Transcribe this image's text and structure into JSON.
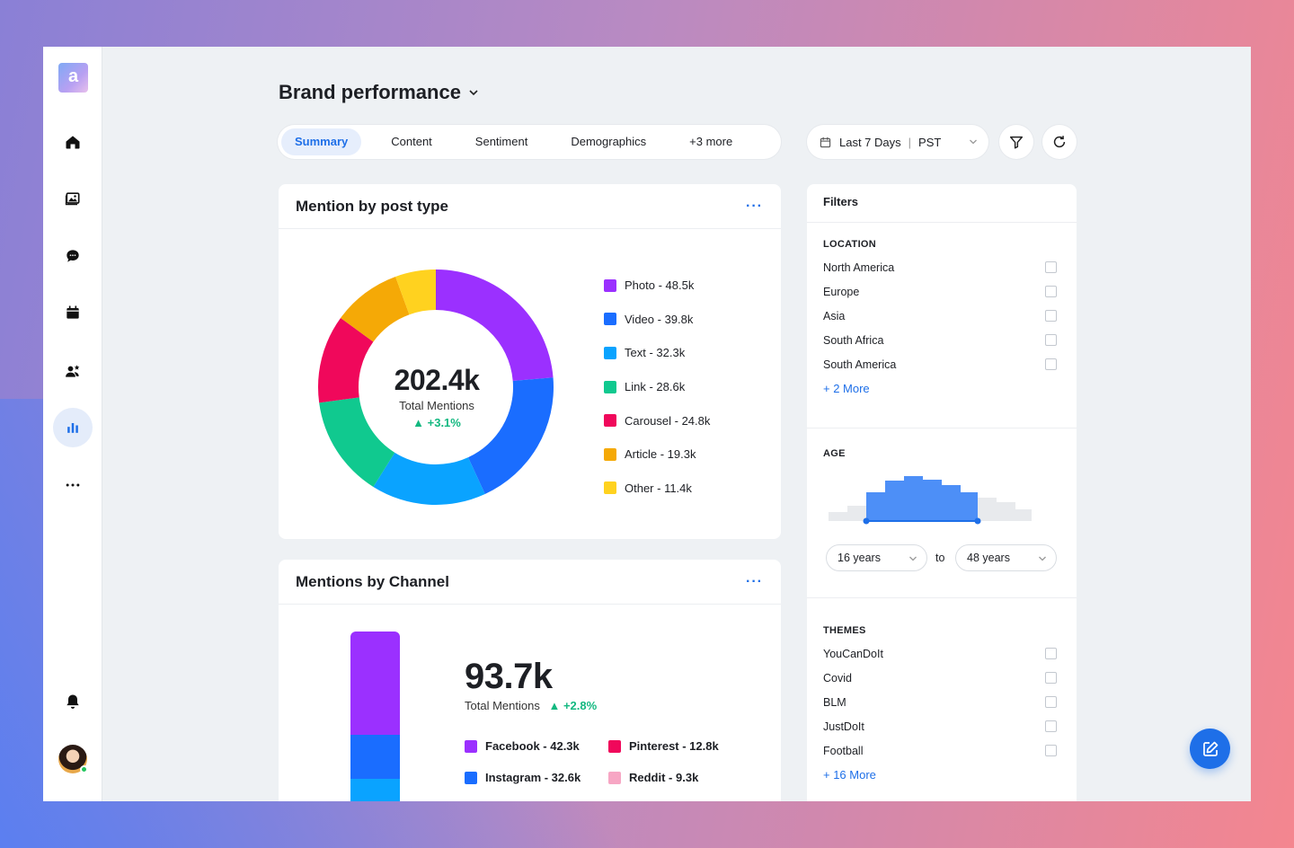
{
  "app": {
    "logo_letter": "a"
  },
  "sidebar": {
    "items": [
      {
        "name": "home",
        "icon": "home-icon"
      },
      {
        "name": "media",
        "icon": "image-icon"
      },
      {
        "name": "messages",
        "icon": "chat-icon"
      },
      {
        "name": "calendar",
        "icon": "calendar-icon"
      },
      {
        "name": "users",
        "icon": "users-star-icon"
      },
      {
        "name": "analytics",
        "icon": "bar-chart-icon",
        "active": true
      },
      {
        "name": "more",
        "icon": "more-horizontal-icon"
      }
    ],
    "bottom": [
      {
        "name": "notifications",
        "icon": "bell-icon"
      },
      {
        "name": "profile",
        "icon": "avatar"
      }
    ]
  },
  "header": {
    "title": "Brand performance",
    "tabs": [
      {
        "label": "Summary",
        "active": true
      },
      {
        "label": "Content"
      },
      {
        "label": "Sentiment"
      },
      {
        "label": "Demographics"
      },
      {
        "label": "+3 more"
      }
    ],
    "date_range": "Last 7 Days",
    "timezone": "PST"
  },
  "mention_by_post_type": {
    "title": "Mention by post type",
    "total": "202.4k",
    "total_label": "Total Mentions",
    "delta": "+3.1%",
    "legend": [
      {
        "label": "Photo - 48.5k",
        "color": "#9b30ff"
      },
      {
        "label": "Video - 39.8k",
        "color": "#1a6dff"
      },
      {
        "label": "Text - 32.3k",
        "color": "#0aa3ff"
      },
      {
        "label": "Link - 28.6k",
        "color": "#10c98f"
      },
      {
        "label": "Carousel - 24.8k",
        "color": "#f0085b"
      },
      {
        "label": "Article - 19.3k",
        "color": "#f5a906"
      },
      {
        "label": "Other - 11.4k",
        "color": "#ffd21f"
      }
    ]
  },
  "chart_data": {
    "type": "pie",
    "categories": [
      "Photo",
      "Video",
      "Text",
      "Link",
      "Carousel",
      "Article",
      "Other"
    ],
    "values": [
      48.5,
      39.8,
      32.3,
      28.6,
      24.8,
      19.3,
      11.4
    ],
    "colors": [
      "#9b30ff",
      "#1a6dff",
      "#0aa3ff",
      "#10c98f",
      "#f0085b",
      "#f5a906",
      "#ffd21f"
    ],
    "title": "Mention by post type"
  },
  "mentions_by_channel": {
    "title": "Mentions by Channel",
    "total": "93.7k",
    "total_label": "Total Mentions",
    "delta": "+2.8%",
    "legend": [
      {
        "label": "Facebook - 42.3k",
        "color": "#9b30ff"
      },
      {
        "label": "Pinterest - 12.8k",
        "color": "#f0085b"
      },
      {
        "label": "Instagram - 32.6k",
        "color": "#1a6dff"
      },
      {
        "label": "Reddit - 9.3k",
        "color": "#f7a6c4"
      }
    ]
  },
  "filters": {
    "title": "Filters",
    "location": {
      "title": "LOCATION",
      "options": [
        "North America",
        "Europe",
        "Asia",
        "South Africa",
        "South America"
      ],
      "more": "+ 2 More"
    },
    "age": {
      "title": "AGE",
      "from": "16 years",
      "to_label": "to",
      "to": "48 years"
    },
    "themes": {
      "title": "THEMES",
      "options": [
        "YouCanDoIt",
        "Covid",
        "BLM",
        "JustDoIt",
        "Football"
      ],
      "more": "+ 16 More"
    }
  }
}
